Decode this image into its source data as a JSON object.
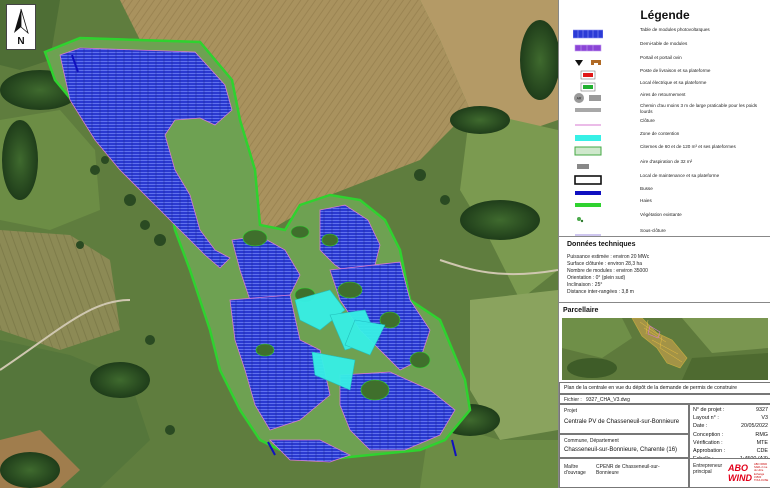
{
  "north_arrow": {
    "label": "N"
  },
  "legend": {
    "title": "Légende",
    "items": [
      {
        "label": "Table de modules photovoltaïques",
        "symbol": "module-table"
      },
      {
        "label": "Demi-table de modules",
        "symbol": "half-table"
      },
      {
        "label": "Portail  et portail ovin",
        "symbol": "gate"
      },
      {
        "label": "Poste de livraison et sa plateforme",
        "symbol": "delivery-station"
      },
      {
        "label": "Local électrique et sa plateforme",
        "symbol": "electrical-room"
      },
      {
        "label": "Aires de retournement",
        "symbol": "turnaround-area"
      },
      {
        "label": "Chemin d'au moins 3 m de large praticable pour les poids lourds",
        "symbol": "heavy-road"
      },
      {
        "label": "Clôture",
        "symbol": "fence"
      },
      {
        "label": "Zone de contention",
        "symbol": "containment-zone"
      },
      {
        "label": "Citernes de 60 et de 120 m³ et ses plateformes",
        "symbol": "tank"
      },
      {
        "label": "Aire d'aspiration de 32 m²",
        "symbol": "suction-area"
      },
      {
        "label": "Local de maintenance et sa plateforme",
        "symbol": "maintenance-room"
      },
      {
        "label": "Busse",
        "symbol": "culvert"
      },
      {
        "label": "Haies",
        "symbol": "hedge"
      },
      {
        "label": "Végétation existante",
        "symbol": "vegetation"
      },
      {
        "label": "Sous-clôture",
        "symbol": "sub-fence"
      }
    ]
  },
  "technical_data": {
    "title": "Données techniques",
    "lines": [
      "Puissance estimée : environ 20 MWc",
      "Surface clôturée : environ 28,3 ha",
      "Nombre de modules : environ 35000",
      "Orientation : 0° (plein sud)",
      "Inclinaison : 25°",
      "Distance inter-rangées : 3,8 m"
    ]
  },
  "parcellaire": {
    "title": "Parcellaire"
  },
  "title_block": {
    "plan_title": "Plan de la centrale en vue du dépôt de la demande de permis de construire",
    "fichier_label": "Fichier :",
    "fichier_value": "9327_CHA_V3.dwg",
    "projet_label": "Projet",
    "projet_value": "Centrale PV de Chasseneuil-sur-Bonnieure",
    "commune_label": "Commune, Département",
    "commune_value": "Chasseneuil-sur-Bonnieure, Charente (16)",
    "moa_label": "Maître d'ouvrage",
    "moa_value": "CPENR de Chasseneuil-sur-Bonnieure",
    "entrepreneur_label": "Entrepreneur principal",
    "logo_text": "ABO WIND",
    "logo_small": "ABO WIND SARL 2 rue du Libre Echange 31500 TOULOUSE",
    "right_fields": [
      {
        "label": "N° de projet :",
        "value": "9327"
      },
      {
        "label": "Layout n° :",
        "value": "V3"
      },
      {
        "label": "Date :",
        "value": "20/05/2022"
      },
      {
        "label": "Conception :",
        "value": "RMG"
      },
      {
        "label": "Vérification :",
        "value": "MTE"
      },
      {
        "label": "Approbation :",
        "value": "CDE"
      },
      {
        "label": "Echelle :",
        "value": "1:4500 (A3)"
      }
    ]
  },
  "colors": {
    "fence": "#d77ad0",
    "modules": "#2b3bd6",
    "containment": "#37f0e6",
    "hedge": "#2fd22f",
    "culvert": "#1010c0"
  }
}
